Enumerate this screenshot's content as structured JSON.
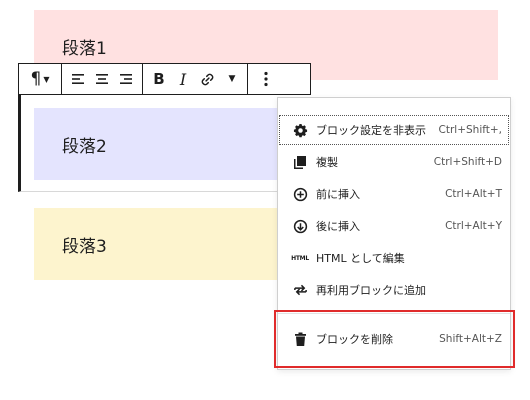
{
  "paragraphs": [
    {
      "text": "段落1",
      "color": "#ffe1e1"
    },
    {
      "text": "段落2",
      "color": "#e4e4fe"
    },
    {
      "text": "段落3",
      "color": "#fdf4ce"
    }
  ],
  "toolbar": {
    "paragraph_icon": "pilcrow-icon",
    "align_left_icon": "align-left-icon",
    "align_center_icon": "align-center-icon",
    "align_right_icon": "align-right-icon",
    "bold_label": "B",
    "italic_label": "I",
    "link_icon": "link-icon",
    "more_icon": "more-vertical-icon"
  },
  "menu": {
    "items": [
      {
        "label": "ブロック設定を非表示",
        "shortcut": "Ctrl+Shift+,",
        "icon": "gear-icon"
      },
      {
        "label": "複製",
        "shortcut": "Ctrl+Shift+D",
        "icon": "duplicate-icon"
      },
      {
        "label": "前に挿入",
        "shortcut": "Ctrl+Alt+T",
        "icon": "insert-before-icon"
      },
      {
        "label": "後に挿入",
        "shortcut": "Ctrl+Alt+Y",
        "icon": "insert-after-icon"
      },
      {
        "label": "HTML として編集",
        "shortcut": "",
        "icon": "html-icon",
        "icon_text": "HTML"
      },
      {
        "label": "再利用ブロックに追加",
        "shortcut": "",
        "icon": "reusable-icon"
      },
      {
        "label": "ブロックを削除",
        "shortcut": "Shift+Alt+Z",
        "icon": "trash-icon"
      }
    ]
  },
  "colors": {
    "highlight": "#e02b2b",
    "text": "#1e1e1e"
  }
}
